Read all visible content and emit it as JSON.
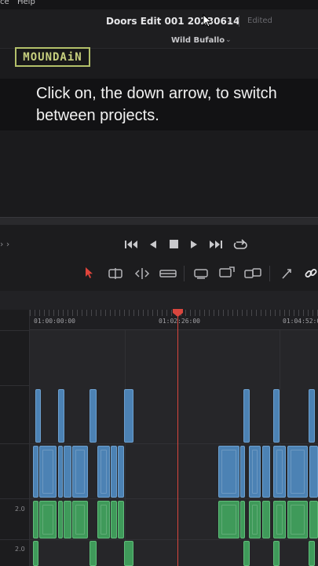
{
  "menu": {
    "partial_left": "ce",
    "help": "Help"
  },
  "title_bar": {
    "project_title": "Doors Edit 001 20230614",
    "status": "Edited"
  },
  "workspace": {
    "name": "Wild Bufallo"
  },
  "logo": {
    "text": "MOUNDAiN"
  },
  "caption": {
    "text": "Click on, the down arrow, to switch between projects."
  },
  "transport": {
    "left_glyph": "› ›"
  },
  "timeline": {
    "timecodes": [
      "01:00:00:00",
      "01:02:26:00",
      "01:04:52:0"
    ],
    "audio_levels": [
      "2.0",
      "2.0"
    ]
  },
  "colors": {
    "video_clip": "#4c82b4",
    "audio_clip": "#3f9a5a",
    "playhead": "#d9463e",
    "logo": "#b3c06a"
  }
}
